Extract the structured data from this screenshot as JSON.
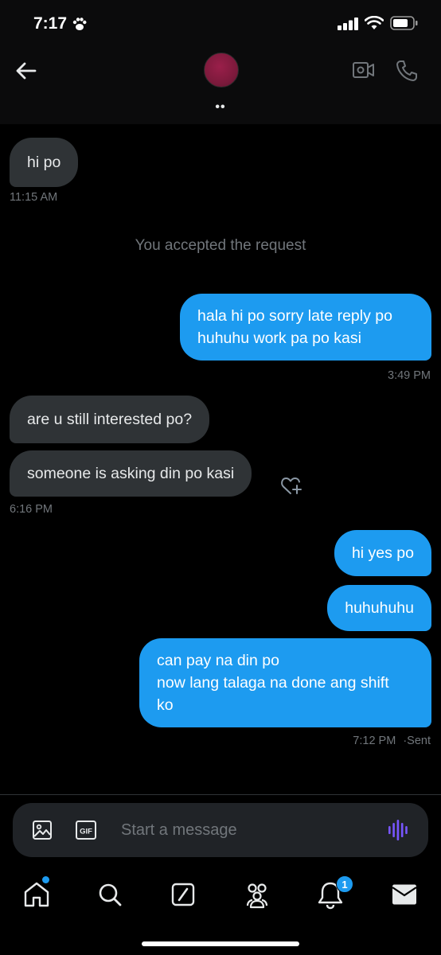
{
  "status_bar": {
    "time": "7:17",
    "icons": [
      "paw-icon",
      "signal-icon",
      "wifi-icon",
      "battery-icon"
    ]
  },
  "header": {
    "contact_name": "••",
    "icons": [
      "back-arrow-icon",
      "video-call-icon",
      "phone-icon"
    ]
  },
  "messages": [
    {
      "direction": "in",
      "text": "hi po"
    },
    {
      "time": "11:15 AM"
    },
    {
      "system": "You accepted the request"
    },
    {
      "direction": "out",
      "lines": [
        "hala hi po sorry late reply po",
        "huhuhu work pa po kasi"
      ]
    },
    {
      "time": "3:49 PM"
    },
    {
      "direction": "in",
      "text": "are u still interested po?"
    },
    {
      "direction": "in",
      "text": "someone is asking din po kasi"
    },
    {
      "time": "6:16 PM"
    },
    {
      "direction": "out",
      "text": "hi yes po"
    },
    {
      "direction": "out",
      "text": "huhuhuhu"
    },
    {
      "direction": "out",
      "lines": [
        "can pay na din po",
        "now lang talaga na done ang shift",
        "ko"
      ]
    },
    {
      "time": "7:12 PM · Sent"
    }
  ],
  "text": {
    "msg1": "hi po",
    "time1": "11:15 AM",
    "system1": "You accepted the request",
    "msg2_line1": "hala hi po sorry late reply po",
    "msg2_line2": "huhuhu work pa po kasi",
    "time2": "3:49 PM",
    "msg3": "are u still interested po?",
    "msg4": "someone is asking din po kasi",
    "time3": "6:16 PM",
    "msg5": "hi yes po",
    "msg6": "huhuhuhu",
    "msg7_line1": "can pay na din po",
    "msg7_line2": "now lang talaga na done ang shift",
    "msg7_line3": "ko",
    "time4": "7:12 PM",
    "time4_status": "·Sent"
  },
  "composer": {
    "placeholder": "Start a message",
    "icons": [
      "image-icon",
      "gif-icon",
      "voice-message-icon"
    ]
  },
  "bottom_nav": {
    "items": [
      "home-icon",
      "search-icon",
      "grok-icon",
      "communities-icon",
      "notifications-icon",
      "messages-icon"
    ],
    "notification_count": "1"
  },
  "colors": {
    "background": "#000000",
    "incoming_bubble": "#2f3336",
    "outgoing_bubble": "#1d9bf0",
    "muted_text": "#71767b",
    "accent": "#1d9bf0",
    "voice_icon": "#7856ff"
  }
}
